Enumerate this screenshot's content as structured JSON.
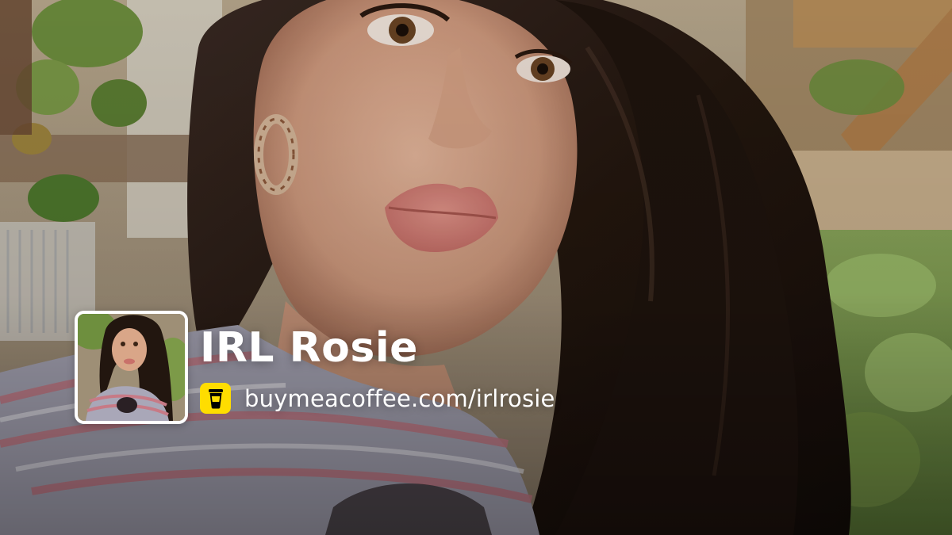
{
  "profile": {
    "name": "IRL Rosie",
    "url": "buymeacoffee.com/irlrosie"
  },
  "icons": {
    "logo": "buymeacoffee-cup-icon",
    "avatar": "profile-photo"
  },
  "colors": {
    "brand_yellow": "#ffdd00",
    "text": "#ffffff"
  }
}
